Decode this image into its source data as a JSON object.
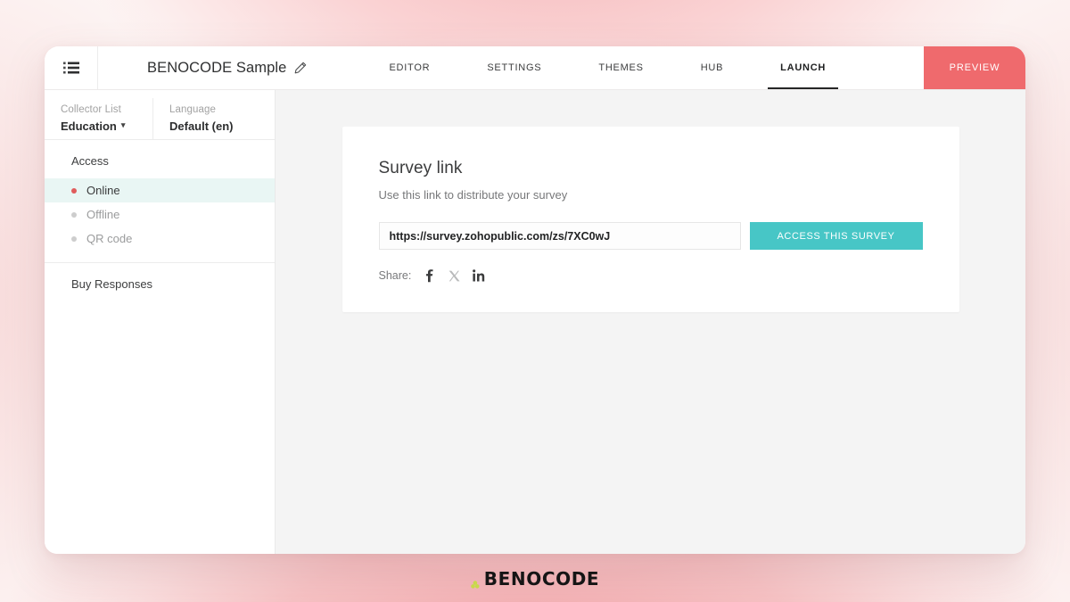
{
  "topbar": {
    "menu_icon": "list-icon",
    "survey_title": "BENOCODE Sample",
    "edit_icon": "pencil-icon",
    "tabs": [
      {
        "label": "EDITOR",
        "active": false
      },
      {
        "label": "SETTINGS",
        "active": false
      },
      {
        "label": "THEMES",
        "active": false
      },
      {
        "label": "HUB",
        "active": false
      },
      {
        "label": "LAUNCH",
        "active": true
      }
    ],
    "preview_label": "PREVIEW",
    "preview_color": "#ef6a6d"
  },
  "sidebar": {
    "collector": {
      "label": "Collector List",
      "value": "Education",
      "caret_icon": "chevron-down-icon"
    },
    "language": {
      "label": "Language",
      "value": "Default (en)"
    },
    "access_header": "Access",
    "items": [
      {
        "label": "Online",
        "active": true,
        "dot_color": "#e05c5c"
      },
      {
        "label": "Offline",
        "active": false,
        "dot_color": "#cdcdcd"
      },
      {
        "label": "QR code",
        "active": false,
        "dot_color": "#cdcdcd"
      }
    ],
    "buy_responses": "Buy Responses",
    "active_row_bg": "#e9f6f4"
  },
  "main": {
    "card": {
      "title": "Survey link",
      "subtitle": "Use this link to distribute your survey",
      "link_value": "https://survey.zohopublic.com/zs/7XC0wJ",
      "link_placeholder": "https://",
      "access_button": "ACCESS THIS SURVEY",
      "access_button_color": "#47c6c6",
      "share_label": "Share:",
      "share_icons": [
        {
          "name": "facebook-icon",
          "glyph": "f"
        },
        {
          "name": "x-twitter-icon",
          "glyph": "X"
        },
        {
          "name": "linkedin-icon",
          "glyph": "in"
        }
      ]
    }
  },
  "footer": {
    "logo_text": "BENOCODE",
    "logo_mark_color": "#c8d94a"
  }
}
